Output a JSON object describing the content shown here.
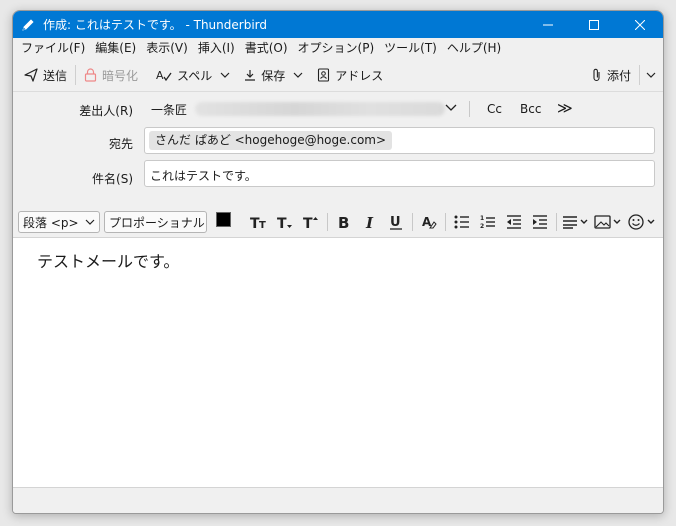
{
  "window": {
    "title": "作成: これはテストです。 - Thunderbird"
  },
  "menu": [
    "ファイル(F)",
    "編集(E)",
    "表示(V)",
    "挿入(I)",
    "書式(O)",
    "オプション(P)",
    "ツール(T)",
    "ヘルプ(H)"
  ],
  "toolbar": {
    "send": "送信",
    "encrypt": "暗号化",
    "spell": "スペル",
    "save": "保存",
    "address": "アドレス",
    "attach": "添付"
  },
  "headers": {
    "from_label": "差出人(R)",
    "from_name": "一条匠",
    "cc": "Cc",
    "bcc": "Bcc",
    "more": "≫",
    "to_label": "宛先",
    "to_recipient": "さんだ ぱあど <hogehoge@hoge.com>",
    "subject_label": "件名(S)",
    "subject_value": "これはテストです。"
  },
  "format": {
    "paragraph": "段落 <p>",
    "font": "プロポーショナル",
    "text_color": "#000000",
    "bg_color": "#ffffff"
  },
  "body": {
    "text": "テストメールです。"
  },
  "colors": {
    "titlebar": "#0078d4"
  }
}
